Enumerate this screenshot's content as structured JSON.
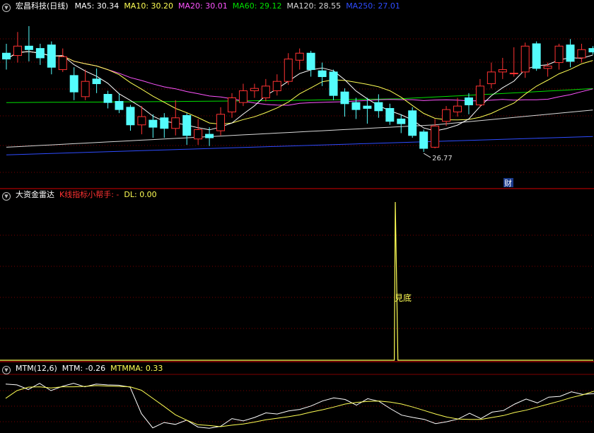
{
  "header_main": {
    "stock": "宏昌科技(日线)",
    "ma": [
      {
        "text": "MA5: 30.34",
        "color": "#ffffff"
      },
      {
        "text": "MA10: 30.20",
        "color": "#ffff54"
      },
      {
        "text": "MA20: 30.01",
        "color": "#ff55ff"
      },
      {
        "text": "MA60: 29.12",
        "color": "#00e000"
      },
      {
        "text": "MA120: 28.55",
        "color": "#d8d8d8"
      },
      {
        "text": "MA250: 27.01",
        "color": "#2e4cff"
      }
    ]
  },
  "header_radar": {
    "name": "大资金雷达",
    "helper": "K线指标小帮手: -",
    "dl": "DL: 0.00"
  },
  "header_mtm": {
    "name": "MTM(12,6)",
    "mtm": "MTM: -0.26",
    "mtmma": "MTMMA: 0.33"
  },
  "icons": {
    "collapse": "collapse-triangle-icon"
  },
  "colors": {
    "up": "#ff3232",
    "down": "#54fcfc",
    "grid": "#7a0000",
    "border": "#aa0000",
    "ma5": "#ffffff",
    "ma10": "#ffff54",
    "ma20": "#ff55ff",
    "ma60": "#00e000",
    "ma120": "#d8d8d8",
    "ma250": "#2e4cff",
    "yellow": "#ffff54"
  },
  "chart_data": [
    {
      "type": "candlestick",
      "ylim": [
        24.5,
        38.2
      ],
      "low_annotation": "26.77",
      "finance_marker": "财",
      "candles": [
        [
          35.0,
          34.5,
          35.8,
          33.6
        ],
        [
          34.8,
          35.6,
          36.8,
          34.2
        ],
        [
          35.6,
          35.3,
          37.3,
          34.3
        ],
        [
          35.4,
          34.6,
          35.8,
          34.0
        ],
        [
          35.7,
          33.8,
          36.0,
          33.2
        ],
        [
          33.6,
          34.7,
          35.4,
          33.4
        ],
        [
          33.1,
          31.7,
          33.8,
          31.0
        ],
        [
          31.3,
          32.6,
          33.6,
          31.0
        ],
        [
          32.8,
          32.4,
          33.7,
          31.6
        ],
        [
          31.5,
          30.8,
          31.8,
          30.3
        ],
        [
          30.9,
          30.2,
          31.6,
          29.9
        ],
        [
          30.4,
          28.9,
          30.6,
          28.4
        ],
        [
          28.9,
          29.6,
          30.5,
          28.1
        ],
        [
          29.3,
          28.7,
          29.8,
          27.8
        ],
        [
          29.5,
          28.6,
          29.9,
          27.8
        ],
        [
          28.6,
          29.5,
          31.0,
          28.0
        ],
        [
          29.7,
          28.0,
          29.9,
          27.2
        ],
        [
          27.7,
          28.5,
          29.4,
          27.2
        ],
        [
          28.1,
          27.8,
          28.7,
          27.1
        ],
        [
          28.4,
          29.8,
          30.4,
          28.0
        ],
        [
          30.0,
          31.2,
          31.6,
          29.5
        ],
        [
          30.8,
          31.8,
          32.4,
          30.5
        ],
        [
          31.8,
          32.0,
          32.4,
          31.2
        ],
        [
          31.2,
          32.2,
          32.8,
          30.9
        ],
        [
          31.8,
          32.6,
          33.2,
          31.4
        ],
        [
          32.6,
          34.5,
          35.0,
          32.3
        ],
        [
          34.4,
          35.0,
          35.4,
          33.6
        ],
        [
          35.0,
          33.6,
          35.2,
          33.0
        ],
        [
          33.5,
          33.0,
          34.2,
          32.2
        ],
        [
          33.4,
          31.4,
          33.6,
          31.0
        ],
        [
          31.7,
          30.7,
          32.0,
          29.6
        ],
        [
          30.8,
          30.2,
          31.2,
          29.4
        ],
        [
          30.5,
          30.3,
          31.2,
          29.0
        ],
        [
          30.8,
          30.1,
          31.5,
          29.5
        ],
        [
          30.3,
          29.2,
          30.7,
          28.9
        ],
        [
          29.4,
          29.0,
          29.8,
          28.2
        ],
        [
          30.1,
          28.0,
          30.4,
          27.8
        ],
        [
          28.3,
          26.9,
          28.5,
          26.6
        ],
        [
          27.0,
          28.8,
          29.4,
          26.9
        ],
        [
          29.2,
          30.2,
          30.5,
          28.8
        ],
        [
          30.0,
          30.5,
          31.2,
          29.6
        ],
        [
          31.2,
          30.6,
          31.6,
          29.8
        ],
        [
          30.6,
          32.2,
          32.8,
          30.4
        ],
        [
          32.4,
          33.4,
          34.2,
          32.0
        ],
        [
          33.4,
          33.6,
          34.6,
          32.8
        ],
        [
          33.3,
          33.3,
          35.5,
          33.0
        ],
        [
          33.4,
          35.6,
          35.9,
          32.9
        ],
        [
          35.8,
          33.7,
          36.0,
          33.5
        ],
        [
          33.7,
          33.9,
          34.2,
          33.0
        ],
        [
          34.2,
          35.6,
          35.8,
          33.6
        ],
        [
          35.7,
          34.3,
          36.2,
          33.8
        ],
        [
          34.6,
          35.3,
          35.8,
          34.2
        ],
        [
          35.4,
          35.1,
          35.6,
          34.9
        ]
      ]
    },
    {
      "type": "line",
      "title": "大资金雷达",
      "ylim": [
        0,
        100
      ],
      "signal_label": "見底",
      "series": [
        {
          "name": "DL",
          "values": [
            0,
            0,
            0,
            0,
            0,
            0,
            0,
            0,
            0,
            0,
            0,
            0,
            0,
            0,
            0,
            0,
            0,
            0,
            0,
            0,
            0,
            0,
            0,
            0,
            0,
            0,
            0,
            0,
            0,
            0,
            0,
            0,
            0,
            0,
            0,
            0,
            0,
            0,
            0,
            0,
            0,
            0,
            0,
            0,
            0,
            0,
            0,
            0,
            0,
            0,
            0,
            0,
            0,
            0,
            0,
            0,
            0,
            0,
            0,
            0,
            0,
            0,
            0,
            0,
            0,
            0,
            0,
            0,
            0,
            0,
            0,
            0,
            0,
            0,
            0,
            0,
            0,
            0,
            0,
            0,
            0,
            0,
            0,
            0,
            0,
            0,
            0,
            0,
            0,
            0,
            0,
            0,
            0,
            0,
            0,
            0,
            0,
            0,
            0,
            0,
            0,
            0,
            0,
            0,
            0,
            0,
            100,
            0,
            0,
            0,
            0,
            0,
            0,
            0,
            0,
            0,
            0,
            0,
            0,
            0,
            0,
            0,
            0,
            0,
            0,
            0,
            0,
            0,
            0,
            0,
            0,
            0,
            0,
            0,
            0,
            0,
            0,
            0,
            0,
            0,
            0,
            0,
            0,
            0,
            0,
            0,
            0,
            0,
            0,
            0,
            0,
            0,
            0,
            0,
            0,
            0,
            0,
            0,
            0,
            0,
            0,
            0,
            0,
            0,
            0
          ]
        }
      ]
    },
    {
      "type": "line",
      "title": "MTM(12,6)",
      "ylim": [
        -10,
        4
      ],
      "x_count": 53,
      "series": [
        {
          "name": "MTM",
          "values": [
            2.2,
            2.0,
            0.8,
            2.4,
            0.5,
            1.6,
            2.4,
            1.5,
            2.2,
            2.0,
            1.9,
            1.4,
            -5.5,
            -9.2,
            -7.8,
            -8.3,
            -7.2,
            -9.0,
            -9.3,
            -8.8,
            -6.8,
            -7.4,
            -6.5,
            -5.3,
            -5.6,
            -4.8,
            -4.4,
            -3.5,
            -2.2,
            -1.4,
            -1.8,
            -3.3,
            -1.6,
            -2.3,
            -4.2,
            -5.9,
            -6.5,
            -7.0,
            -8.1,
            -7.6,
            -6.9,
            -5.4,
            -6.8,
            -5.1,
            -4.7,
            -3.0,
            -1.7,
            -2.7,
            -1.2,
            -1.0,
            0.2,
            -0.5,
            -0.3
          ]
        },
        {
          "name": "MTMMA",
          "values": [
            -1.5,
            0.5,
            1.4,
            1.5,
            1.2,
            1.5,
            1.5,
            1.6,
            1.8,
            1.7,
            1.6,
            1.5,
            0.6,
            -1.5,
            -3.6,
            -5.8,
            -7.2,
            -8.4,
            -8.6,
            -8.9,
            -8.5,
            -8.2,
            -7.7,
            -7.1,
            -6.7,
            -6.3,
            -5.8,
            -5.1,
            -4.5,
            -3.8,
            -3.0,
            -2.6,
            -2.3,
            -2.2,
            -2.5,
            -3.0,
            -3.8,
            -4.7,
            -5.6,
            -6.4,
            -6.9,
            -7.0,
            -7.0,
            -6.5,
            -6.0,
            -5.2,
            -4.6,
            -3.8,
            -3.0,
            -2.2,
            -1.3,
            -0.6,
            0.33
          ]
        }
      ]
    }
  ]
}
